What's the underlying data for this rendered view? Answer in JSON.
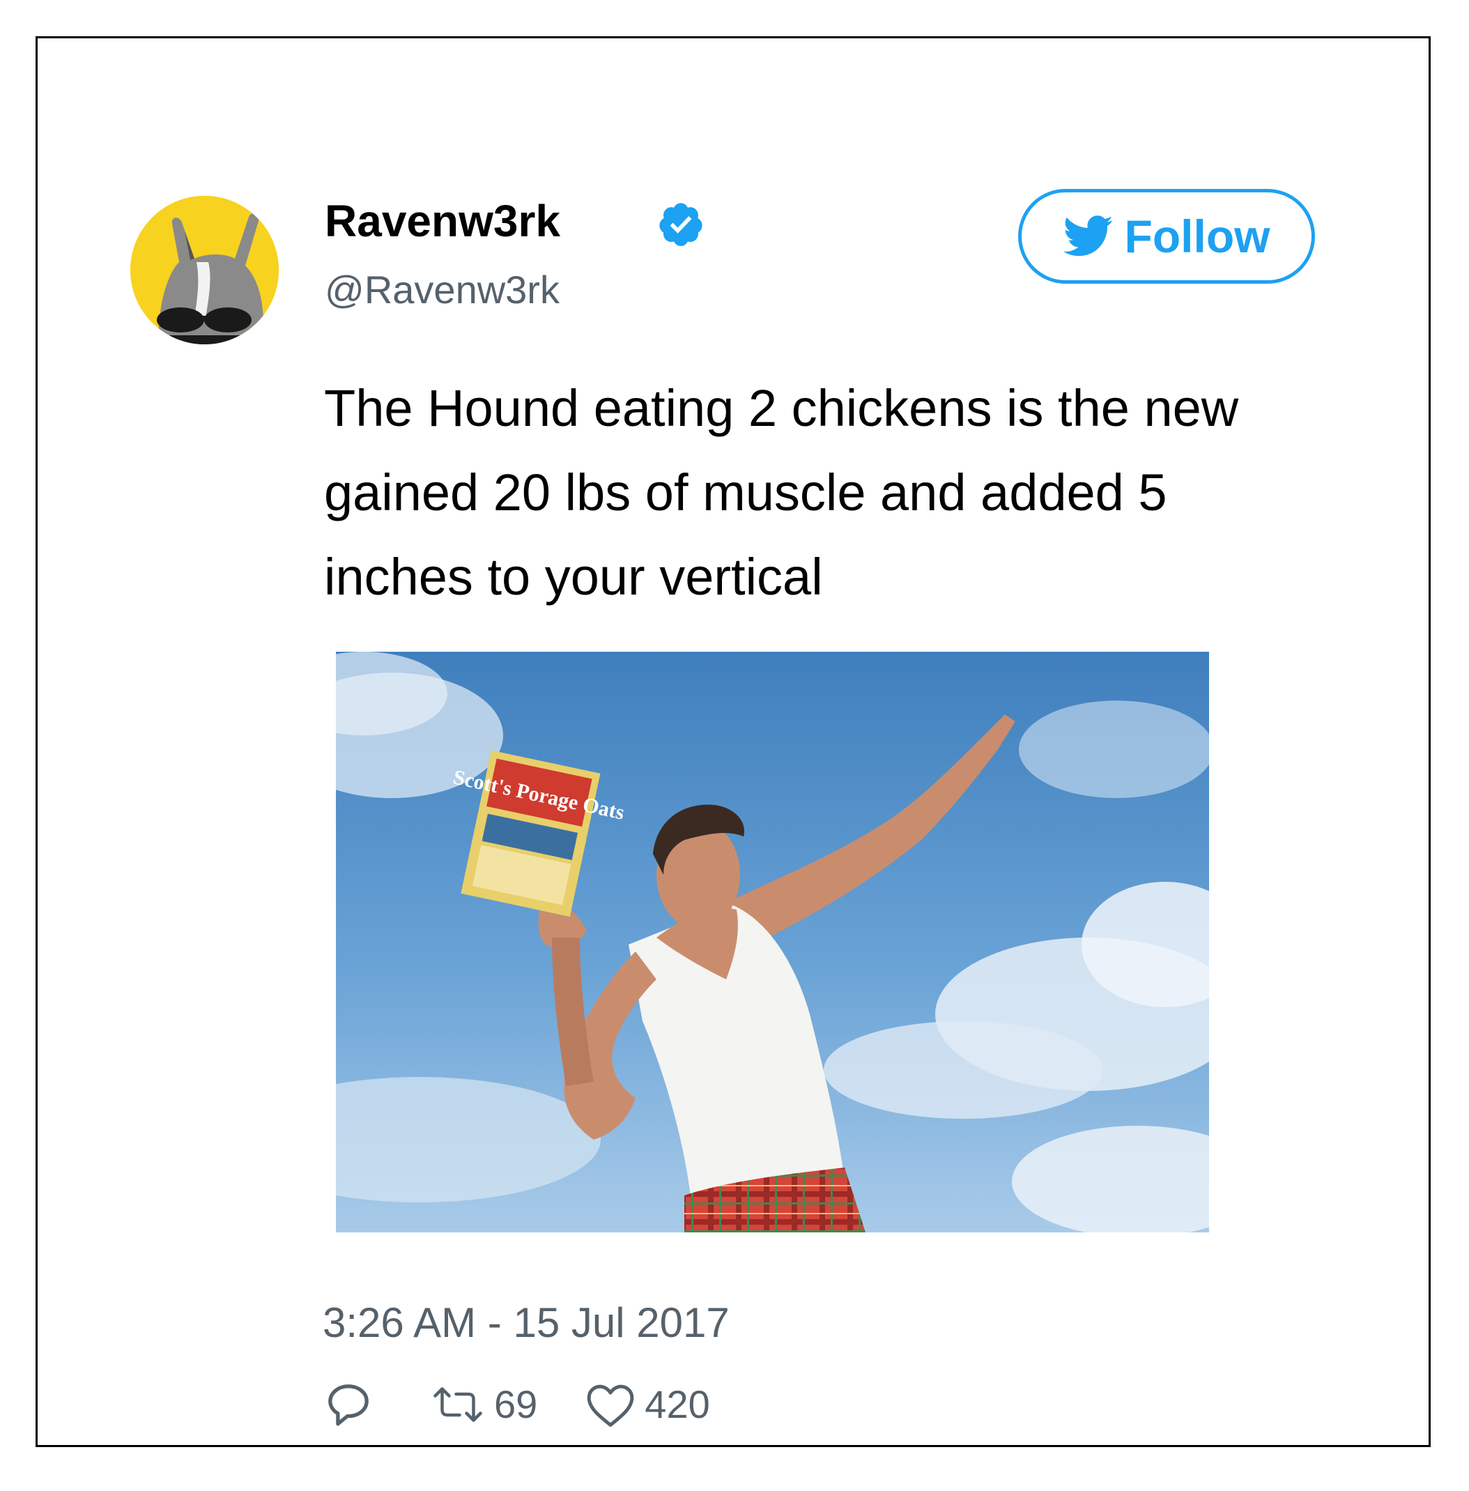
{
  "user": {
    "display_name": "Ravenw3rk",
    "handle": "@Ravenw3rk",
    "verified_icon": "verified-badge-icon",
    "avatar_icon": "avatar-rabbit-sunglasses"
  },
  "follow_button": {
    "label": "Follow",
    "icon": "bird-icon"
  },
  "tweet": {
    "text": "The Hound eating 2 chickens is the new gained 20 lbs of muscle and added 5 inches to your vertical",
    "timestamp": "3:26 AM - 15 Jul 2017"
  },
  "media": {
    "box_label": "Scott's Porage Oats"
  },
  "actions": {
    "reply_icon": "reply-icon",
    "retweet_icon": "retweet-icon",
    "retweet_count": "69",
    "like_icon": "heart-icon",
    "like_count": "420"
  },
  "colors": {
    "accent": "#1da1f2",
    "muted": "#55616b",
    "avatar_bg": "#f7d21e"
  }
}
